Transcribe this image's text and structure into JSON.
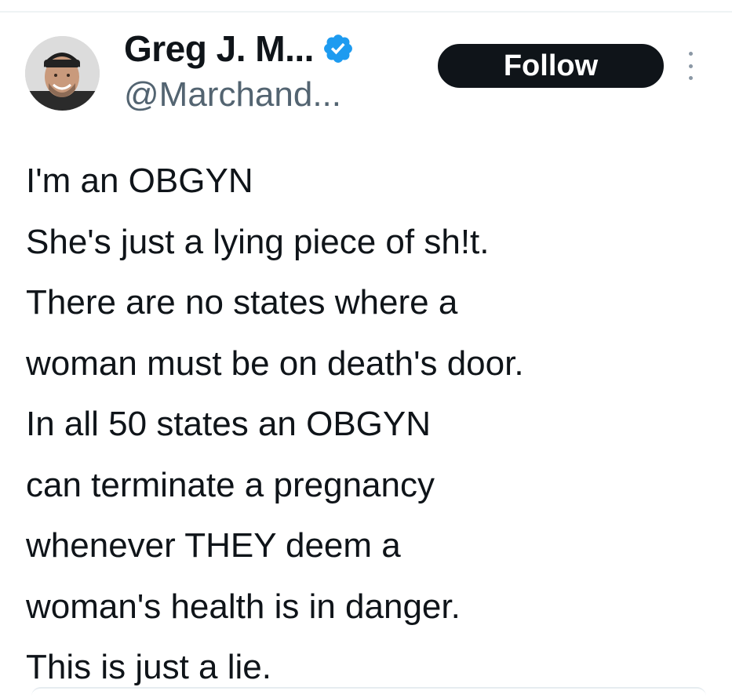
{
  "author": {
    "display_name": "Greg J. M...",
    "handle": "@Marchand...",
    "verified_icon": "verified-badge-icon",
    "avatar_icon": "avatar"
  },
  "actions": {
    "follow_label": "Follow",
    "more_icon": "more-options-icon"
  },
  "tweet": {
    "lines": [
      "I'm an OBGYN",
      "She's just a lying piece of sh!t.",
      "There are no states where a",
      "woman must be on death's door.",
      "In all 50 states an OBGYN",
      "can terminate a pregnancy",
      "whenever THEY deem a",
      "woman's health is in danger.",
      "This is just a lie."
    ]
  },
  "colors": {
    "text": "#0f1419",
    "secondary_text": "#536471",
    "verified_blue": "#1d9bf0",
    "button_bg": "#0f1419"
  }
}
